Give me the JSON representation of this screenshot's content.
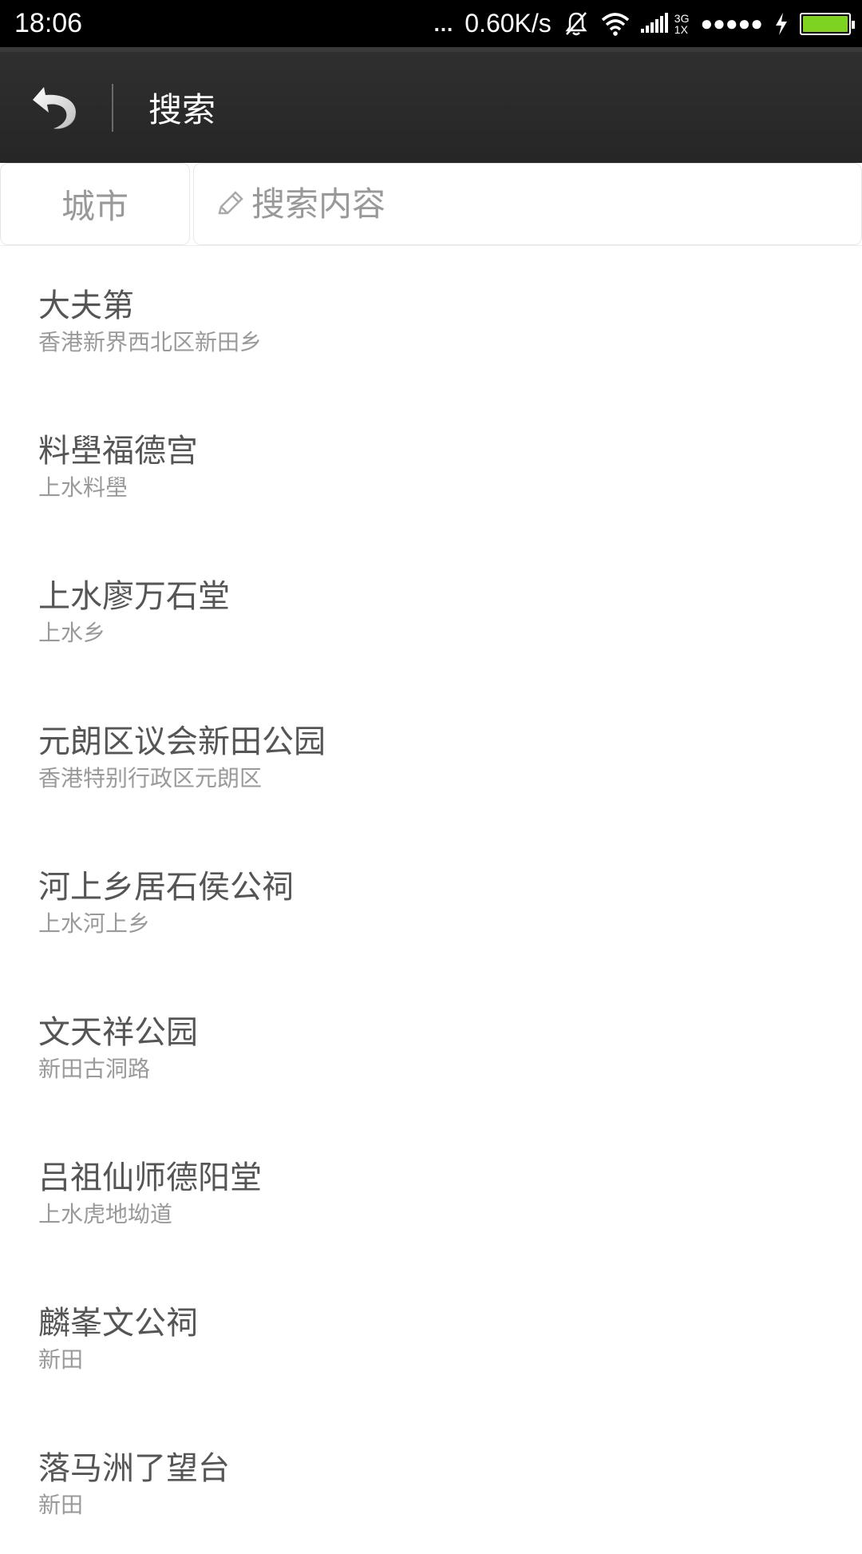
{
  "status_bar": {
    "time": "18:06",
    "dots": "...",
    "net_speed": "0.60K/s",
    "network_type_top": "3G",
    "network_type_bottom": "1X",
    "signal_dots": "●●●●●",
    "battery_color": "#7ed321",
    "icons": [
      "mute-icon",
      "wifi-icon",
      "signal-icon",
      "charging-icon",
      "battery-icon"
    ]
  },
  "header": {
    "title": "搜索",
    "back_icon": "back-arrow-icon"
  },
  "search": {
    "city_label": "城市",
    "placeholder": "搜索内容",
    "value": "",
    "icon": "pencil-icon"
  },
  "results": [
    {
      "name": "大夫第",
      "address": "香港新界西北区新田乡"
    },
    {
      "name": "料壆福德宫",
      "address": "上水料壆"
    },
    {
      "name": "上水廖万石堂",
      "address": "上水乡"
    },
    {
      "name": "元朗区议会新田公园",
      "address": "香港特别行政区元朗区"
    },
    {
      "name": "河上乡居石侯公祠",
      "address": "上水河上乡"
    },
    {
      "name": "文天祥公园",
      "address": "新田古洞路"
    },
    {
      "name": "吕祖仙师德阳堂",
      "address": "上水虎地坳道"
    },
    {
      "name": "麟峯文公祠",
      "address": "新田"
    },
    {
      "name": "落马洲了望台",
      "address": "新田"
    }
  ]
}
